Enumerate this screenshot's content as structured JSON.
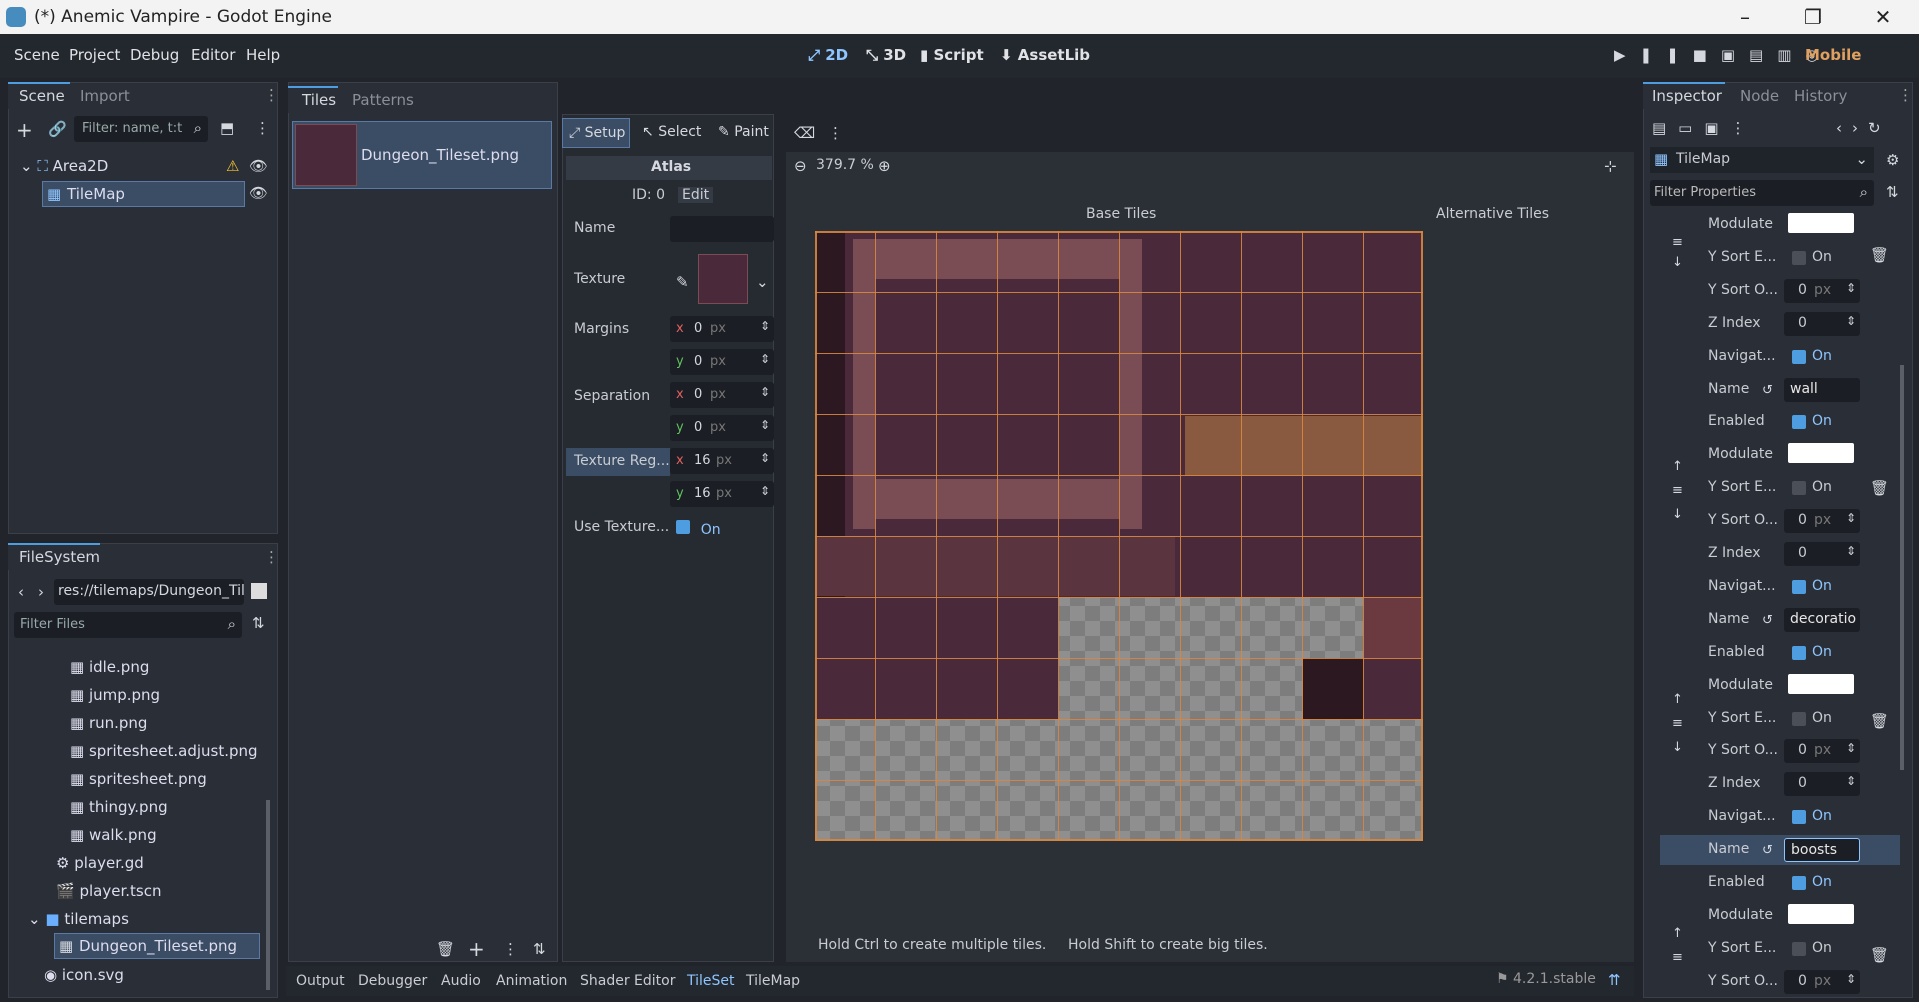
{
  "window": {
    "title": "(*) Anemic Vampire - Godot Engine"
  },
  "menu": [
    "Scene",
    "Project",
    "Debug",
    "Editor",
    "Help"
  ],
  "workspaces": [
    "2D",
    "3D",
    "Script",
    "AssetLib"
  ],
  "renderer": "Mobile",
  "scene_panel": {
    "tabs": [
      "Scene",
      "Import"
    ],
    "filter_placeholder": "Filter: name, t:t",
    "nodes": [
      "Area2D",
      "TileMap"
    ]
  },
  "filesystem": {
    "tab": "FileSystem",
    "path": "res://tilemaps/Dungeon_Til",
    "filter_placeholder": "Filter Files",
    "items": [
      "idle.png",
      "jump.png",
      "run.png",
      "spritesheet.adjust.png",
      "spritesheet.png",
      "thingy.png",
      "walk.png",
      "player.gd",
      "player.tscn",
      "tilemaps",
      "Dungeon_Tileset.png",
      "icon.svg"
    ]
  },
  "tileset_panel": {
    "tabs": [
      "Tiles",
      "Patterns"
    ],
    "source": "Dungeon_Tileset.png"
  },
  "atlas": {
    "modes": [
      "Setup",
      "Select",
      "Paint"
    ],
    "title": "Atlas",
    "id": "ID: 0",
    "edit": "Edit",
    "name_label": "Name",
    "texture_label": "Texture",
    "margins_label": "Margins",
    "separation_label": "Separation",
    "texture_region_label": "Texture Reg...",
    "use_texture_label": "Use Texture...",
    "on": "On",
    "x": "x",
    "y": "y",
    "margin_x": "0",
    "margin_y": "0",
    "sep_x": "0",
    "sep_y": "0",
    "region_x": "16",
    "region_y": "16",
    "px": "px"
  },
  "viewer": {
    "zoom": "379.7 %",
    "base_tiles": "Base Tiles",
    "alt_tiles": "Alternative Tiles",
    "hint1": "Hold Ctrl to create multiple tiles.",
    "hint2": "Hold Shift to create big tiles."
  },
  "bottom_tabs": [
    "Output",
    "Debugger",
    "Audio",
    "Animation",
    "Shader Editor",
    "TileSet",
    "TileMap"
  ],
  "version": "4.2.1.stable",
  "inspector": {
    "tabs": [
      "Inspector",
      "Node",
      "History"
    ],
    "object": "TileMap",
    "filter_placeholder": "Filter Properties",
    "rows": [
      {
        "label": "Modulate",
        "type": "color"
      },
      {
        "label": "Y Sort E...",
        "type": "check",
        "value": "On",
        "checked": false
      },
      {
        "label": "Y Sort O...",
        "type": "num",
        "value": "0",
        "unit": "px"
      },
      {
        "label": "Z Index",
        "type": "num",
        "value": "0"
      },
      {
        "label": "Navigat...",
        "type": "check",
        "value": "On",
        "checked": true
      },
      {
        "label": "Name",
        "type": "text",
        "value": "wall"
      },
      {
        "label": "Enabled",
        "type": "check",
        "value": "On",
        "checked": true
      },
      {
        "label": "Modulate",
        "type": "color"
      },
      {
        "label": "Y Sort E...",
        "type": "check",
        "value": "On",
        "checked": false
      },
      {
        "label": "Y Sort O...",
        "type": "num",
        "value": "0",
        "unit": "px"
      },
      {
        "label": "Z Index",
        "type": "num",
        "value": "0"
      },
      {
        "label": "Navigat...",
        "type": "check",
        "value": "On",
        "checked": true
      },
      {
        "label": "Name",
        "type": "text",
        "value": "decoratio"
      },
      {
        "label": "Enabled",
        "type": "check",
        "value": "On",
        "checked": true
      },
      {
        "label": "Modulate",
        "type": "color"
      },
      {
        "label": "Y Sort E...",
        "type": "check",
        "value": "On",
        "checked": false
      },
      {
        "label": "Y Sort O...",
        "type": "num",
        "value": "0",
        "unit": "px"
      },
      {
        "label": "Z Index",
        "type": "num",
        "value": "0"
      },
      {
        "label": "Navigat...",
        "type": "check",
        "value": "On",
        "checked": true
      },
      {
        "label": "Name",
        "type": "text",
        "value": "boosts"
      },
      {
        "label": "Enabled",
        "type": "check",
        "value": "On",
        "checked": true
      },
      {
        "label": "Modulate",
        "type": "color"
      },
      {
        "label": "Y Sort E...",
        "type": "check",
        "value": "On",
        "checked": false
      },
      {
        "label": "Y Sort O...",
        "type": "num",
        "value": "0",
        "unit": "px"
      }
    ]
  }
}
